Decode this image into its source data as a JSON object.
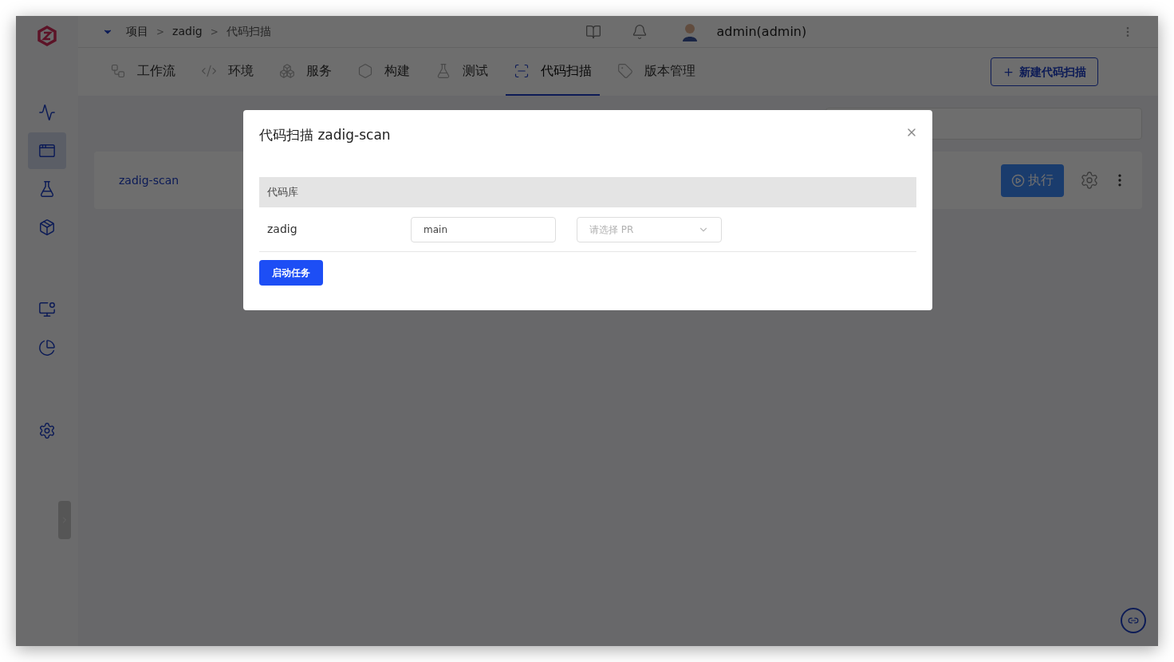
{
  "breadcrumb": {
    "separator": ">",
    "items": [
      "项目",
      "zadig",
      "代码扫描"
    ]
  },
  "header": {
    "user": "admin(admin)"
  },
  "sidebar": {
    "items": [
      {
        "kind": "monitor",
        "selected": false
      },
      {
        "kind": "project",
        "selected": true
      },
      {
        "kind": "test",
        "selected": false
      },
      {
        "kind": "delivery",
        "selected": false
      },
      {
        "kind": "dashboard",
        "selected": false
      },
      {
        "kind": "insight",
        "selected": false
      },
      {
        "kind": "settings",
        "selected": false
      }
    ]
  },
  "tabs": [
    {
      "label": "工作流",
      "kind": "workflow",
      "selected": false
    },
    {
      "label": "环境",
      "kind": "env",
      "selected": false
    },
    {
      "label": "服务",
      "kind": "service",
      "selected": false
    },
    {
      "label": "构建",
      "kind": "build",
      "selected": false
    },
    {
      "label": "测试",
      "kind": "test",
      "selected": false
    },
    {
      "label": "代码扫描",
      "kind": "scan",
      "selected": true
    },
    {
      "label": "版本管理",
      "kind": "version",
      "selected": false
    }
  ],
  "new_button": "新建代码扫描",
  "scans": [
    {
      "name": "zadig-scan",
      "run_label": "执行"
    }
  ],
  "dialog": {
    "title": "代码扫描 zadig-scan",
    "section": "代码库",
    "repos": [
      {
        "name": "zadig",
        "branch": "main",
        "pr_placeholder": "请选择 PR"
      }
    ],
    "start_button": "启动任务"
  }
}
